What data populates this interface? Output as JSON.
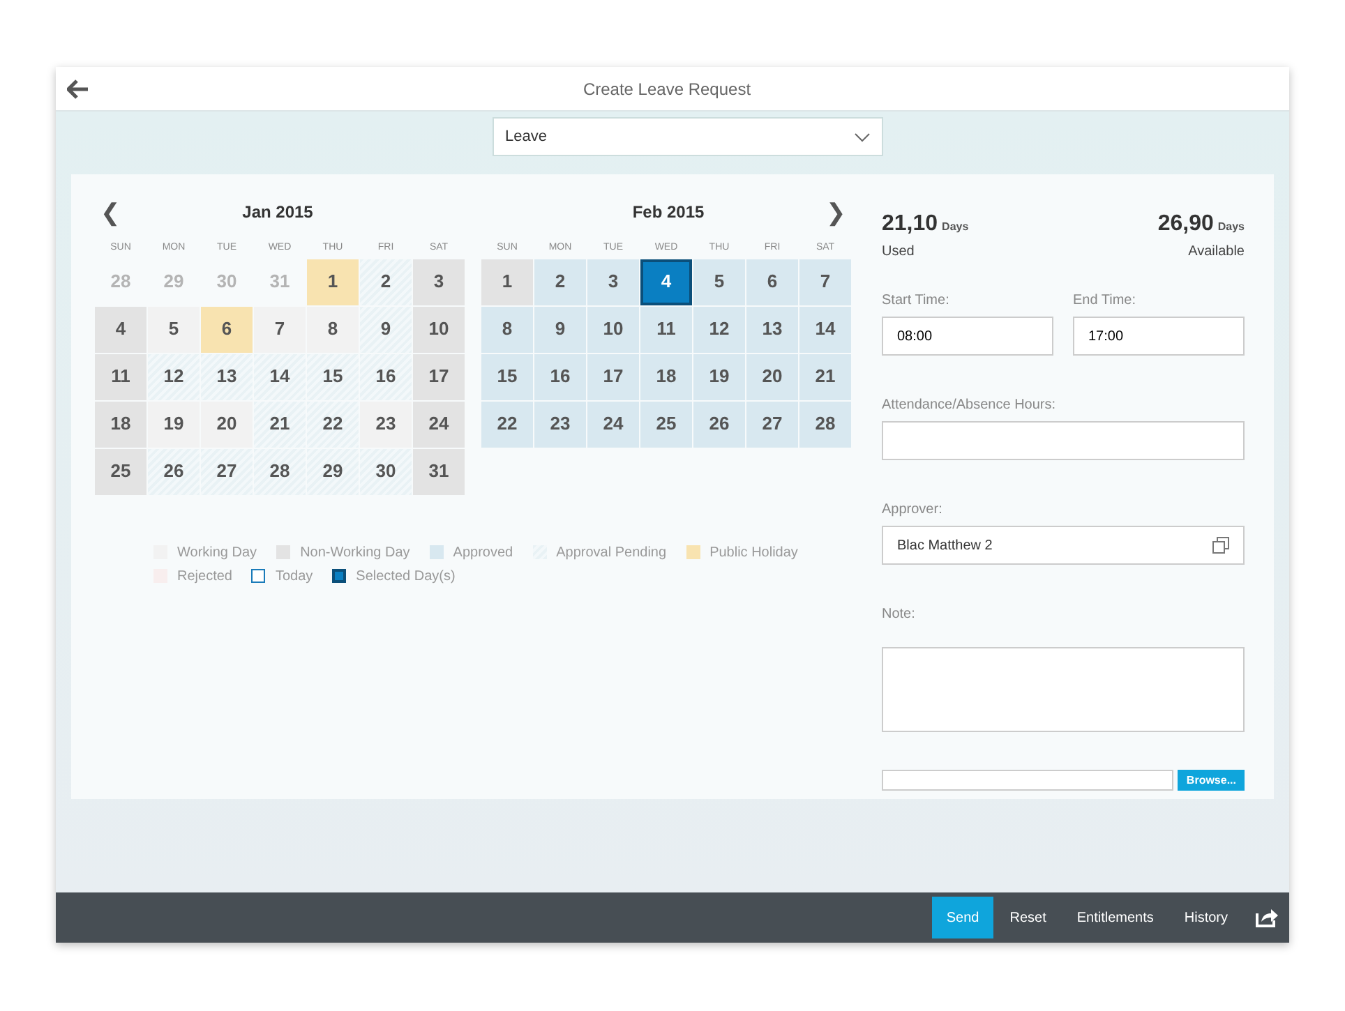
{
  "header": {
    "title": "Create Leave Request"
  },
  "leave_type": {
    "value": "Leave"
  },
  "calendars": [
    {
      "title": "Jan 2015",
      "nav": "❮",
      "weekdays": [
        "SUN",
        "MON",
        "TUE",
        "WED",
        "THU",
        "FRI",
        "SAT"
      ],
      "days": [
        {
          "label": "28",
          "kind": "other"
        },
        {
          "label": "29",
          "kind": "other"
        },
        {
          "label": "30",
          "kind": "other"
        },
        {
          "label": "31",
          "kind": "other"
        },
        {
          "label": "1",
          "kind": "holiday"
        },
        {
          "label": "2",
          "kind": "pending"
        },
        {
          "label": "3",
          "kind": "nonworking"
        },
        {
          "label": "4",
          "kind": "nonworking"
        },
        {
          "label": "5",
          "kind": "working"
        },
        {
          "label": "6",
          "kind": "holiday"
        },
        {
          "label": "7",
          "kind": "working"
        },
        {
          "label": "8",
          "kind": "working"
        },
        {
          "label": "9",
          "kind": "pending"
        },
        {
          "label": "10",
          "kind": "nonworking"
        },
        {
          "label": "11",
          "kind": "nonworking"
        },
        {
          "label": "12",
          "kind": "pending"
        },
        {
          "label": "13",
          "kind": "pending"
        },
        {
          "label": "14",
          "kind": "pending"
        },
        {
          "label": "15",
          "kind": "pending"
        },
        {
          "label": "16",
          "kind": "pending"
        },
        {
          "label": "17",
          "kind": "nonworking"
        },
        {
          "label": "18",
          "kind": "nonworking"
        },
        {
          "label": "19",
          "kind": "working"
        },
        {
          "label": "20",
          "kind": "working"
        },
        {
          "label": "21",
          "kind": "pending"
        },
        {
          "label": "22",
          "kind": "pending"
        },
        {
          "label": "23",
          "kind": "working"
        },
        {
          "label": "24",
          "kind": "nonworking"
        },
        {
          "label": "25",
          "kind": "nonworking"
        },
        {
          "label": "26",
          "kind": "pending"
        },
        {
          "label": "27",
          "kind": "pending"
        },
        {
          "label": "28",
          "kind": "pending"
        },
        {
          "label": "29",
          "kind": "pending"
        },
        {
          "label": "30",
          "kind": "pending"
        },
        {
          "label": "31",
          "kind": "nonworking"
        }
      ]
    },
    {
      "title": "Feb 2015",
      "nav": "❯",
      "weekdays": [
        "SUN",
        "MON",
        "TUE",
        "WED",
        "THU",
        "FRI",
        "SAT"
      ],
      "days": [
        {
          "label": "1",
          "kind": "nonworking"
        },
        {
          "label": "2",
          "kind": "approved"
        },
        {
          "label": "3",
          "kind": "approved"
        },
        {
          "label": "4",
          "kind": "selected"
        },
        {
          "label": "5",
          "kind": "approved"
        },
        {
          "label": "6",
          "kind": "approved"
        },
        {
          "label": "7",
          "kind": "approved"
        },
        {
          "label": "8",
          "kind": "approved"
        },
        {
          "label": "9",
          "kind": "approved"
        },
        {
          "label": "10",
          "kind": "approved"
        },
        {
          "label": "11",
          "kind": "approved"
        },
        {
          "label": "12",
          "kind": "approved"
        },
        {
          "label": "13",
          "kind": "approved"
        },
        {
          "label": "14",
          "kind": "approved"
        },
        {
          "label": "15",
          "kind": "approved"
        },
        {
          "label": "16",
          "kind": "approved"
        },
        {
          "label": "17",
          "kind": "approved"
        },
        {
          "label": "18",
          "kind": "approved"
        },
        {
          "label": "19",
          "kind": "approved"
        },
        {
          "label": "20",
          "kind": "approved"
        },
        {
          "label": "21",
          "kind": "approved"
        },
        {
          "label": "22",
          "kind": "approved"
        },
        {
          "label": "23",
          "kind": "approved"
        },
        {
          "label": "24",
          "kind": "approved"
        },
        {
          "label": "25",
          "kind": "approved"
        },
        {
          "label": "26",
          "kind": "approved"
        },
        {
          "label": "27",
          "kind": "approved"
        },
        {
          "label": "28",
          "kind": "approved"
        }
      ]
    }
  ],
  "legend": [
    {
      "label": "Working Day",
      "kind": "working"
    },
    {
      "label": "Non-Working Day",
      "kind": "nonworking"
    },
    {
      "label": "Approved",
      "kind": "approved"
    },
    {
      "label": "Approval Pending",
      "kind": "pending"
    },
    {
      "label": "Public Holiday",
      "kind": "holiday"
    },
    {
      "label": "Rejected",
      "kind": "rejected"
    },
    {
      "label": "Today",
      "kind": "today"
    },
    {
      "label": "Selected Day(s)",
      "kind": "selected"
    }
  ],
  "balances": [
    {
      "value": "21,10",
      "unit": "Days",
      "caption": "Used"
    },
    {
      "value": "26,90",
      "unit": "Days",
      "caption": "Available"
    }
  ],
  "start_time": {
    "label": "Start Time:",
    "value": "08:00"
  },
  "end_time": {
    "label": "End Time:",
    "value": "17:00"
  },
  "hours": {
    "label": "Attendance/Absence Hours:"
  },
  "approver": {
    "label": "Approver:",
    "value": "Blac Matthew 2"
  },
  "note": {
    "label": "Note:"
  },
  "upload": {
    "button": "Browse..."
  },
  "footer_buttons": [
    {
      "label": "Send",
      "selected": true
    },
    {
      "label": "Reset",
      "selected": false
    },
    {
      "label": "Entitlements",
      "selected": false
    },
    {
      "label": "History",
      "selected": false
    }
  ]
}
